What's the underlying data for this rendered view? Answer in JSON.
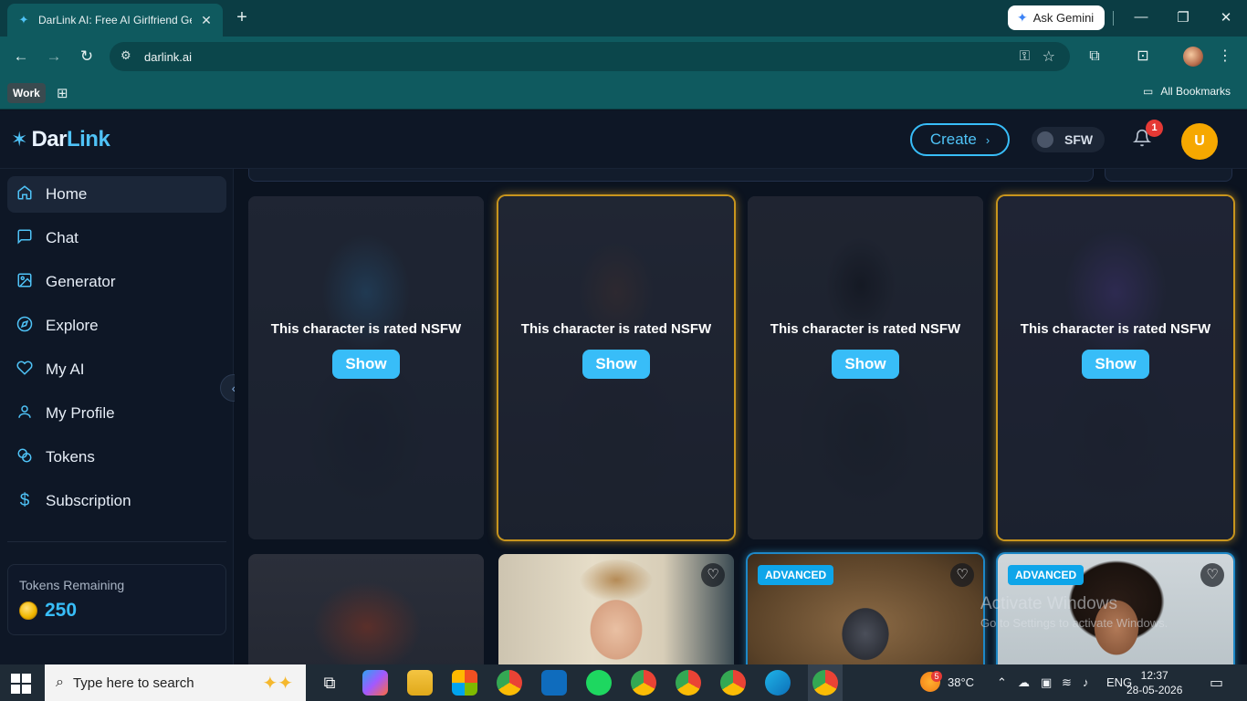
{
  "browser": {
    "tab_title": "DarLink AI: Free AI Girlfriend Ge",
    "url": "darlink.ai",
    "ask_gemini": "Ask Gemini",
    "bookmark_work": "Work",
    "all_bookmarks": "All Bookmarks"
  },
  "header": {
    "logo_dar": "Dar",
    "logo_link": "Link",
    "create_label": "Create",
    "sfw_label": "SFW",
    "notif_count": "1",
    "avatar_initial": "U"
  },
  "sidebar": {
    "items": [
      {
        "label": "Home",
        "icon": "home-icon"
      },
      {
        "label": "Chat",
        "icon": "chat-icon"
      },
      {
        "label": "Generator",
        "icon": "image-icon"
      },
      {
        "label": "Explore",
        "icon": "compass-icon"
      },
      {
        "label": "My AI",
        "icon": "heart-icon"
      },
      {
        "label": "My Profile",
        "icon": "user-icon"
      },
      {
        "label": "Tokens",
        "icon": "coins-icon"
      },
      {
        "label": "Subscription",
        "icon": "dollar-icon"
      }
    ],
    "tokens_label": "Tokens Remaining",
    "tokens_value": "250"
  },
  "cards": {
    "nsfw_text": "This character is rated NSFW",
    "show_label": "Show",
    "advanced_label": "ADVANCED"
  },
  "watermark": {
    "line1": "Activate Windows",
    "line2": "Go to Settings to activate Windows."
  },
  "taskbar": {
    "search_placeholder": "Type here to search",
    "weather": "38°C",
    "weather_badge": "5",
    "lang": "ENG",
    "time": "12:37",
    "date": "28-05-2026"
  },
  "colors": {
    "accent": "#38bdf8",
    "gold_border": "#c8951d",
    "avatar": "#f6a800"
  }
}
